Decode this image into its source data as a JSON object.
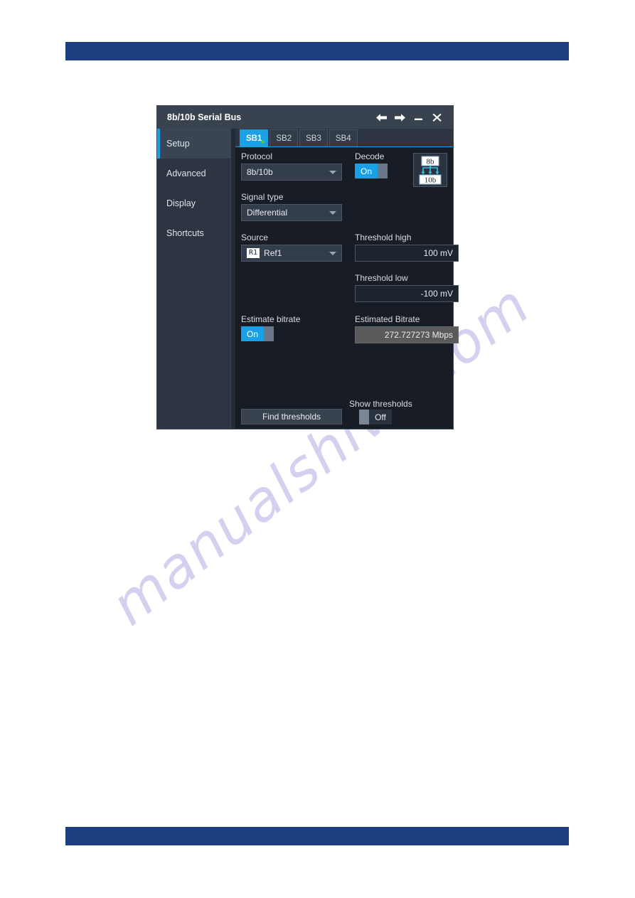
{
  "page": {
    "header_bar_color": "#1d3f7f",
    "footer_bar_color": "#1d3f7f",
    "watermark_text": "manualshive.com"
  },
  "dialog": {
    "title": "8b/10b Serial Bus",
    "titlebar_buttons": [
      {
        "name": "back-arrow-icon",
        "glyph": "←"
      },
      {
        "name": "forward-arrow-icon",
        "glyph": "→"
      },
      {
        "name": "minimize-icon",
        "glyph": "—"
      },
      {
        "name": "close-icon",
        "glyph": "✕"
      }
    ],
    "accent_color": "#1aa0e6"
  },
  "sidebar": {
    "items": [
      {
        "label": "Setup",
        "active": true
      },
      {
        "label": "Advanced",
        "active": false
      },
      {
        "label": "Display",
        "active": false
      },
      {
        "label": "Shortcuts",
        "active": false
      }
    ]
  },
  "tabs": [
    {
      "label": "SB1",
      "active": true,
      "status_dot": true,
      "dot_color": "#3fd23f"
    },
    {
      "label": "SB2",
      "active": false,
      "status_dot": false
    },
    {
      "label": "SB3",
      "active": false,
      "status_dot": false
    },
    {
      "label": "SB4",
      "active": false,
      "status_dot": false
    }
  ],
  "form": {
    "protocol": {
      "label": "Protocol",
      "value": "8b/10b"
    },
    "signal_type": {
      "label": "Signal type",
      "value": "Differential"
    },
    "source": {
      "label": "Source",
      "badge": "R1",
      "value": "Ref1"
    },
    "decode": {
      "label": "Decode",
      "value": "On"
    },
    "protocol_icon": {
      "name": "8b10b-protocol-icon",
      "top_label": "8b",
      "bottom_label": "10b"
    },
    "threshold_high": {
      "label": "Threshold high",
      "value": "100 mV"
    },
    "threshold_low": {
      "label": "Threshold low",
      "value": "-100 mV"
    },
    "estimate_bitrate": {
      "label": "Estimate bitrate",
      "value": "On"
    },
    "estimated_bitrate": {
      "label": "Estimated Bitrate",
      "value": "272.727273 Mbps"
    },
    "find_thresholds": {
      "label": "Find thresholds"
    },
    "show_thresholds": {
      "label": "Show thresholds",
      "value": "Off"
    }
  }
}
